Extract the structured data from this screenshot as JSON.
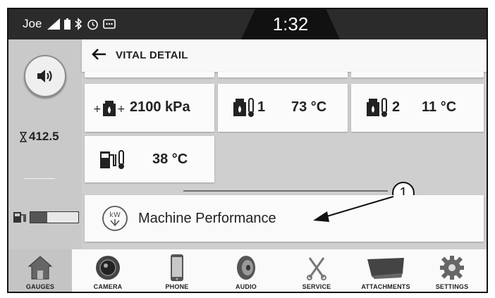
{
  "status": {
    "user": "Joe",
    "time": "1:32"
  },
  "left_rail": {
    "hours": "412.5",
    "fuel_level": 0.35
  },
  "header": {
    "title": "VITAL DETAIL"
  },
  "vitals": {
    "pressure": "2100 kPa",
    "hyd1_index": "1",
    "hyd1_temp": "73 °C",
    "hyd2_index": "2",
    "hyd2_temp": "11 °C",
    "fuel_temp": "38 °C"
  },
  "callout": "1",
  "performance": {
    "icon_text": "kW",
    "label": "Machine Performance"
  },
  "nav": {
    "gauges": "GAUGES",
    "camera": "CAMERA",
    "phone": "PHONE",
    "audio": "AUDIO",
    "service": "SERVICE",
    "attachments": "ATTACHMENTS",
    "settings": "SETTINGS"
  }
}
